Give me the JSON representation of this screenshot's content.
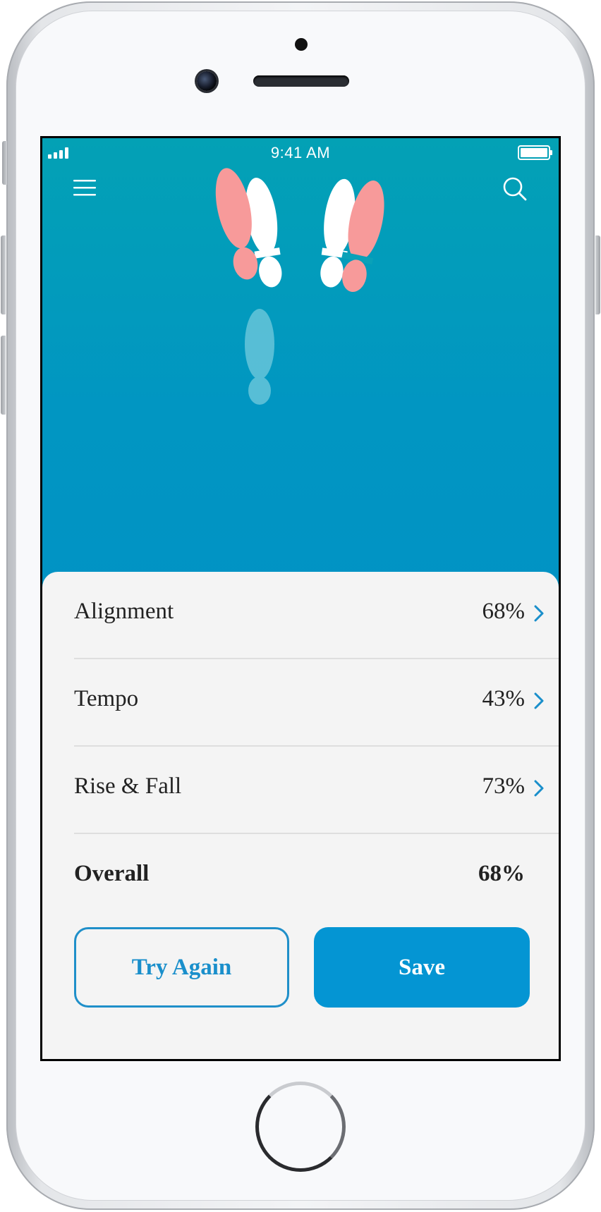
{
  "status_bar": {
    "time": "9:41 AM"
  },
  "header": {
    "menu_icon": "hamburger-menu-icon",
    "search_icon": "search-icon"
  },
  "illustration": {
    "icon": "footprints-icon",
    "colors": {
      "left_foot_pink": "#f79a9a",
      "white_foot": "#ffffff",
      "shadow_foot": "#6ac6da"
    }
  },
  "results": {
    "rows": [
      {
        "label": "Alignment",
        "value": "68%"
      },
      {
        "label": "Tempo",
        "value": "43%"
      },
      {
        "label": "Rise & Fall",
        "value": "73%"
      }
    ],
    "overall": {
      "label": "Overall",
      "value": "68%"
    }
  },
  "actions": {
    "try_again_label": "Try Again",
    "save_label": "Save"
  },
  "colors": {
    "hero_top": "#03a1b5",
    "hero_bottom": "#0193c4",
    "accent": "#0495d3",
    "chevron": "#1a8fcb"
  }
}
